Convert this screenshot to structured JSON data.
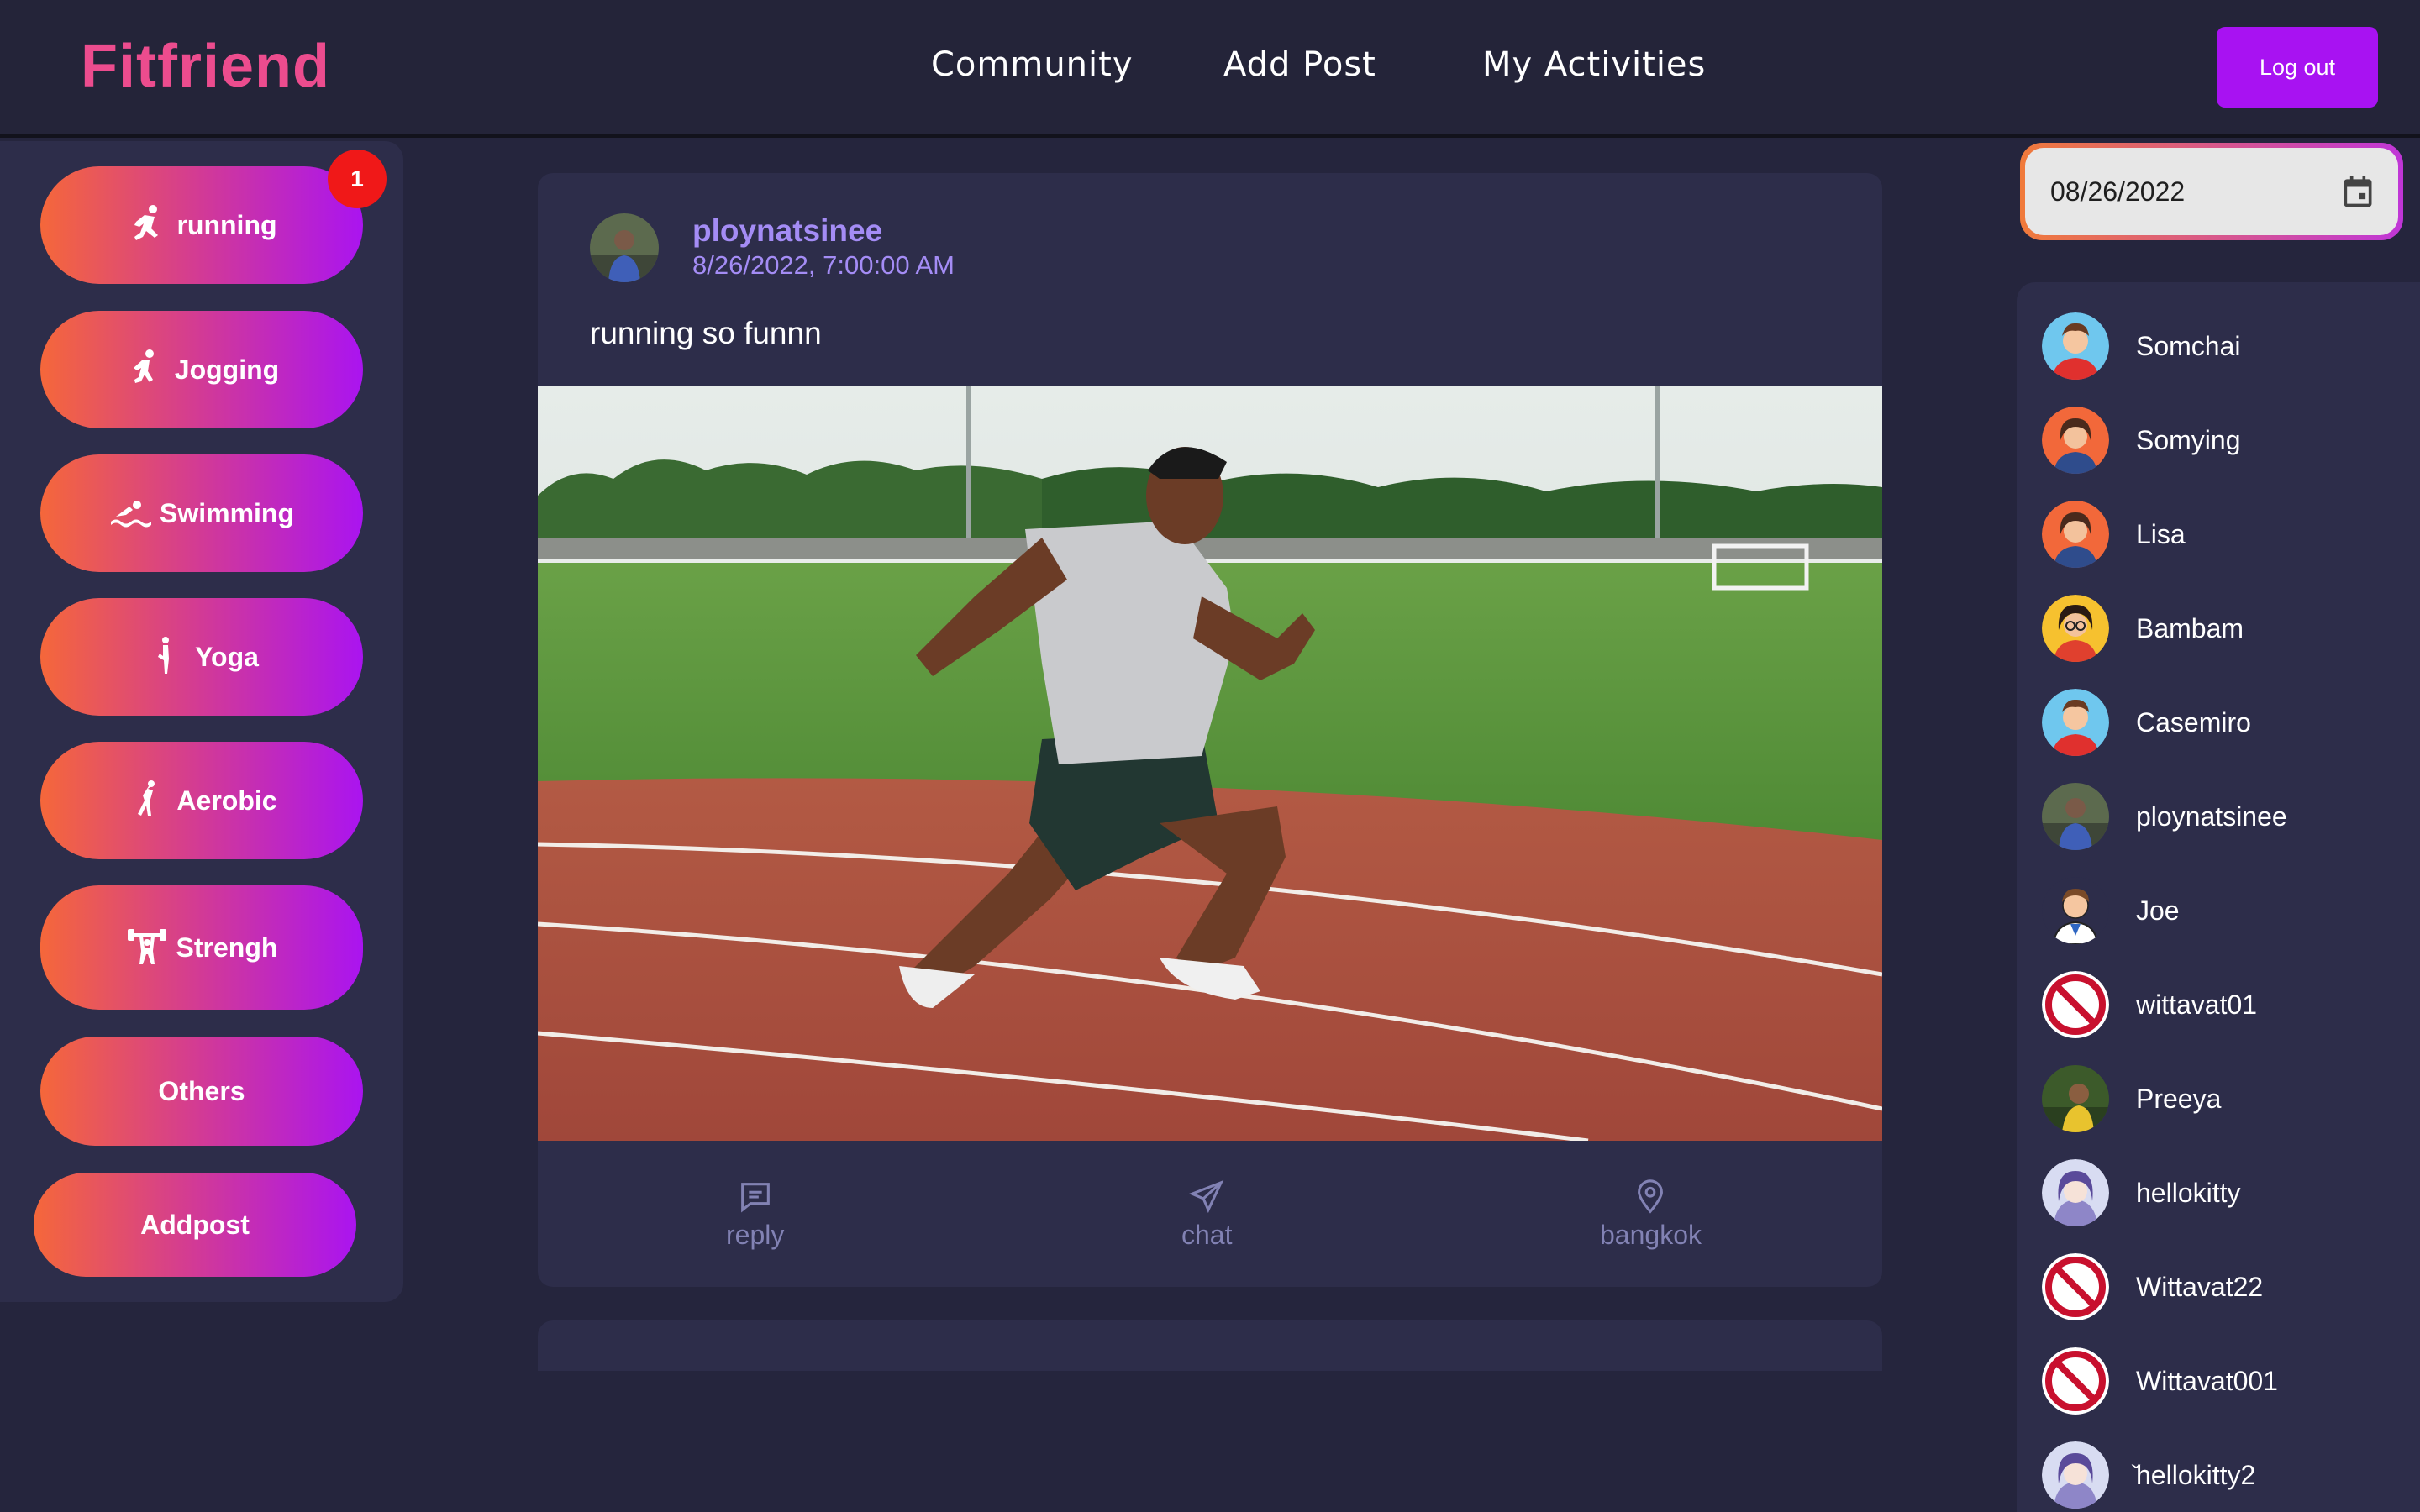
{
  "app": {
    "brand": "Fitfriend"
  },
  "nav": {
    "community": "Community",
    "add_post": "Add Post",
    "my_activities": "My Activities",
    "logout": "Log out"
  },
  "sidebar": {
    "badge_count": "1",
    "categories": [
      {
        "label": "running",
        "icon": "running-icon"
      },
      {
        "label": "Jogging",
        "icon": "jogging-icon"
      },
      {
        "label": "Swimming",
        "icon": "swimming-icon"
      },
      {
        "label": "Yoga",
        "icon": "yoga-icon"
      },
      {
        "label": "Aerobic",
        "icon": "aerobic-icon"
      },
      {
        "label": "Strengh",
        "icon": "weightlifting-icon"
      },
      {
        "label": "Others",
        "icon": ""
      },
      {
        "label": "Addpost",
        "icon": ""
      }
    ]
  },
  "post": {
    "username": "ploynatsinee",
    "timestamp": "8/26/2022, 7:00:00 AM",
    "text": "running so funnn",
    "photo": "sprinter-on-running-track",
    "actions": {
      "reply": "reply",
      "chat": "chat",
      "location": "bangkok"
    }
  },
  "date_filter": {
    "value": "08/26/2022",
    "icon": "calendar-icon"
  },
  "users": [
    {
      "name": "Somchai",
      "avatar": "cartoon-man-avatar"
    },
    {
      "name": "Somying",
      "avatar": "cartoon-woman-avatar"
    },
    {
      "name": "Lisa",
      "avatar": "cartoon-woman-avatar"
    },
    {
      "name": "Bambam",
      "avatar": "cartoon-glasses-avatar"
    },
    {
      "name": "Casemiro",
      "avatar": "cartoon-man-avatar"
    },
    {
      "name": "ploynatsinee",
      "avatar": "photo-avatar"
    },
    {
      "name": "Joe",
      "avatar": "cartoon-man-avatar"
    },
    {
      "name": "wittavat01",
      "avatar": "no-entry-avatar"
    },
    {
      "name": "Preeya",
      "avatar": "photo-avatar"
    },
    {
      "name": "hellokitty",
      "avatar": "anime-girl-avatar"
    },
    {
      "name": "Wittavat22",
      "avatar": "no-entry-avatar"
    },
    {
      "name": "Wittavat001",
      "avatar": "no-entry-avatar"
    },
    {
      "name": "̌hellokitty2",
      "avatar": "anime-girl-avatar"
    }
  ],
  "colors": {
    "background": "#25253d",
    "panel": "#2d2d4a",
    "accent_purple": "#a812f2",
    "brand_pink": "#ec4c8e",
    "username_lavender": "#a48cf5"
  }
}
